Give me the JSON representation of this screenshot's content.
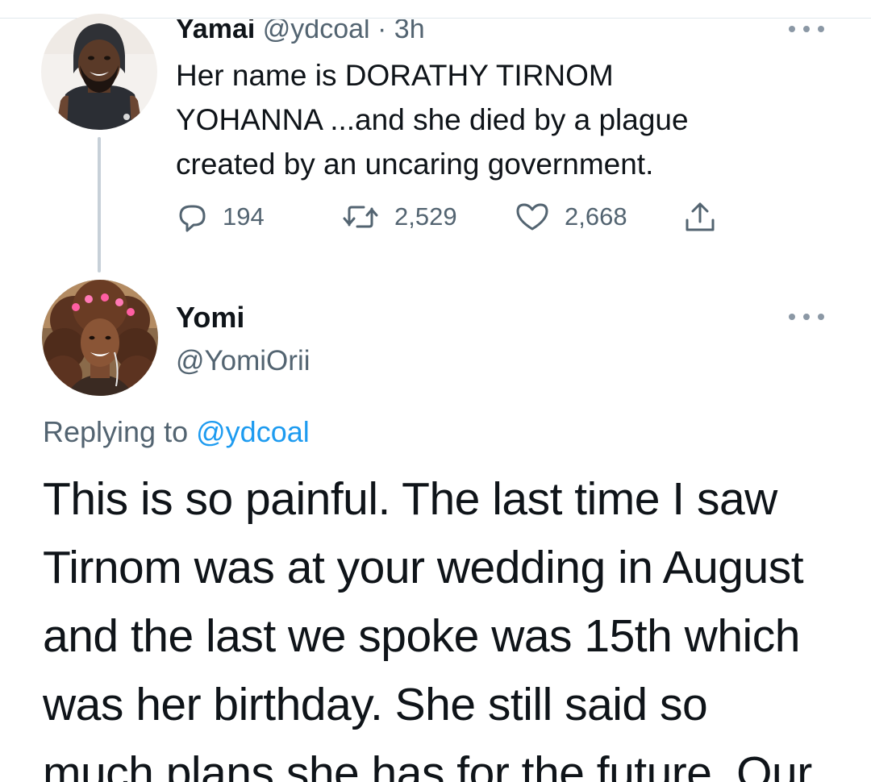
{
  "parent_tweet": {
    "author_name": "Yamai",
    "handle": "@ydcoal",
    "separator": "·",
    "time": "3h",
    "text_lines": [
      "Her name is DORATHY TIRNOM",
      "YOHANNA ...and she died by a plague",
      "created by an uncaring government."
    ],
    "reply_count": "194",
    "retweet_count": "2,529",
    "like_count": "2,668",
    "icons": {
      "reply": "speech-bubble-icon",
      "retweet": "retweet-icon",
      "like": "heart-icon",
      "share": "share-icon",
      "more": "ellipsis-icon"
    }
  },
  "reply_tweet": {
    "author_name": "Yomi",
    "handle": "@YomiOrii",
    "replying_to_label": "Replying to",
    "replying_to_handle": "@ydcoal",
    "text_lines": [
      "This is so painful. The last time I saw",
      "Tirnom was at your wedding in August",
      "and the last we spoke was 15th which",
      "was her birthday. She still said so",
      "much plans she has for the future. Our"
    ]
  },
  "colors": {
    "text": "#0f1419",
    "secondary": "#536471",
    "link": "#1d9bf0",
    "thread_line": "#c7d0d8"
  }
}
